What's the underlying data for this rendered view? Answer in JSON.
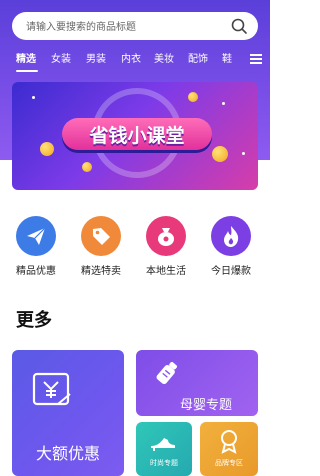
{
  "search": {
    "placeholder": "请输入要搜索的商品标题",
    "icon": "search-icon"
  },
  "tabs": [
    {
      "label": "精选",
      "active": true
    },
    {
      "label": "女装"
    },
    {
      "label": "男装"
    },
    {
      "label": "内衣"
    },
    {
      "label": "美妆"
    },
    {
      "label": "配饰"
    },
    {
      "label": "鞋"
    }
  ],
  "banner": {
    "title": "省钱小课堂"
  },
  "categories": [
    {
      "label": "精品优惠",
      "icon": "paper-plane-icon",
      "color": "#3d7be6"
    },
    {
      "label": "精选特卖",
      "icon": "tag-icon",
      "color": "#f08a3a"
    },
    {
      "label": "本地生活",
      "icon": "money-bag-icon",
      "color": "#e83a7a"
    },
    {
      "label": "今日爆款",
      "icon": "flame-icon",
      "color": "#7b3fe4"
    }
  ],
  "more": {
    "heading": "更多"
  },
  "cards": {
    "big_discount": {
      "label": "大额优惠",
      "icon": "coupon-icon"
    },
    "baby": {
      "label": "母婴专题",
      "icon": "baby-bottle-icon"
    },
    "fashion": {
      "label": "时尚专题",
      "icon": "high-heel-icon"
    },
    "brand": {
      "label": "品牌专区",
      "icon": "badge-icon"
    }
  },
  "colors": {
    "header_start": "#5b3fd9",
    "header_end": "#8e5bf0",
    "accent_purple": "#7a4fe8"
  }
}
